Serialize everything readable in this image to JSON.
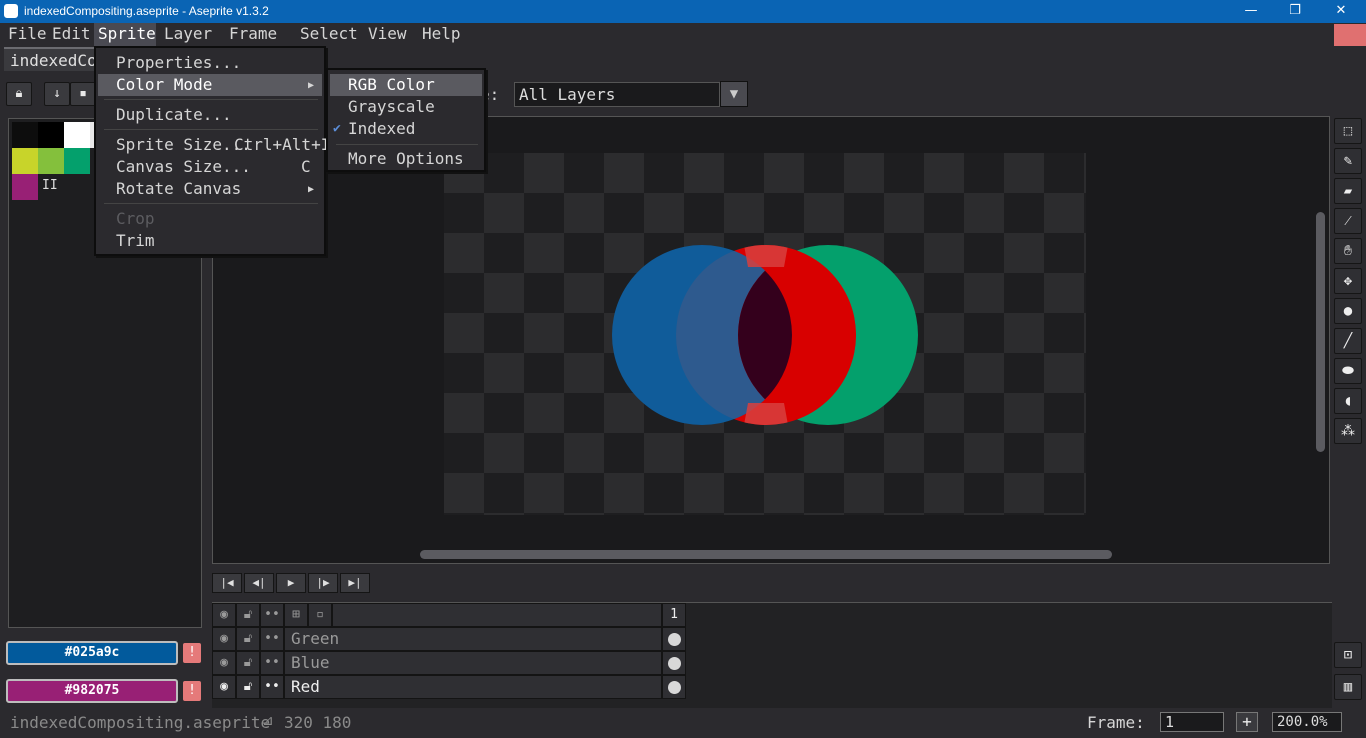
{
  "window": {
    "title": "indexedCompositing.aseprite - Aseprite v1.3.2",
    "minimize": "—",
    "maximize": "❐",
    "close": "✕"
  },
  "menubar": [
    "File",
    "Edit",
    "Sprite",
    "Layer",
    "Frame",
    "Select",
    "View",
    "Help"
  ],
  "tab": {
    "label": "indexedCompositing.aseprite"
  },
  "toolbar": {
    "layers_label": "e:",
    "layers_value": "All Layers"
  },
  "sprite_menu": {
    "properties": "Properties...",
    "color_mode": "Color Mode",
    "duplicate": "Duplicate...",
    "sprite_size": "Sprite Size...",
    "sprite_size_shortcut": "Ctrl+Alt+I",
    "canvas_size": "Canvas Size...",
    "canvas_size_shortcut": "C",
    "rotate_canvas": "Rotate Canvas",
    "crop": "Crop",
    "trim": "Trim"
  },
  "color_mode_menu": {
    "rgb": "RGB Color",
    "grayscale": "Grayscale",
    "indexed": "Indexed",
    "more": "More Options",
    "checked": "Indexed"
  },
  "palette": {
    "colors": [
      "#0d0d0d",
      "#000000",
      "#ffffff",
      "#e8e8e8",
      "#c8d42a",
      "#84c03c",
      "#04a06c",
      "#982075"
    ],
    "more_label": "II"
  },
  "colors": {
    "foreground": "#025a9c",
    "background": "#982075",
    "foreground_label": "#025a9c",
    "background_label": "#982075"
  },
  "timeline": {
    "frame_header": "1",
    "layers": [
      {
        "name": "Green",
        "visible": false
      },
      {
        "name": "Blue",
        "visible": false
      },
      {
        "name": "Red",
        "visible": true
      }
    ]
  },
  "status": {
    "file": "indexedCompositing.aseprite",
    "size": "320 180",
    "frame_label": "Frame:",
    "frame_value": "1",
    "zoom": "200.0%"
  }
}
